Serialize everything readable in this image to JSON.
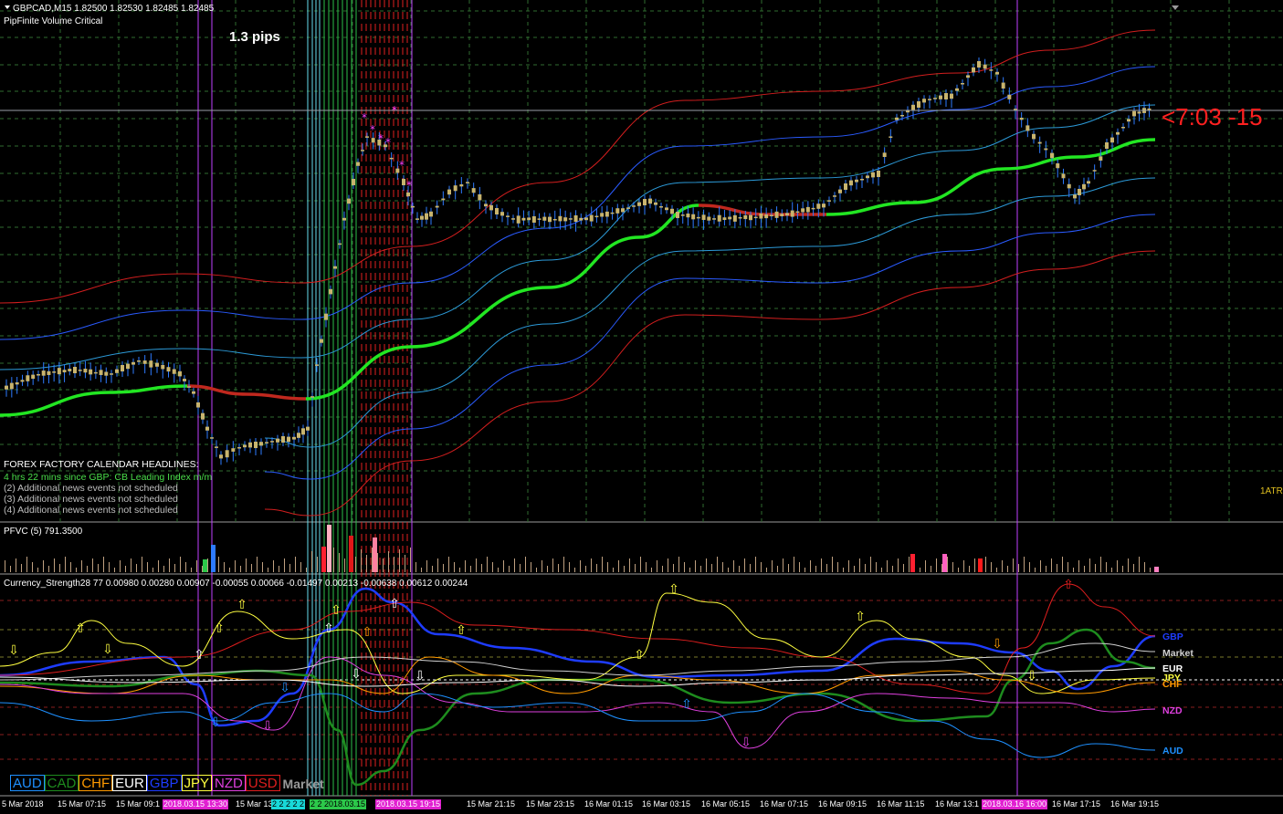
{
  "header": {
    "symbol_line": "GBPCAD,M15  1.82500 1.82530 1.82485 1.82485",
    "indicator_name": "PipFinite Volume Critical"
  },
  "spread_label": "1.3 pips",
  "timer_label": "<7:03  -15",
  "atr_label": "1ATR",
  "news": {
    "title": "FOREX FACTORY CALENDAR HEADLINES:",
    "line1": "4 hrs 22 mins since GBP: CB Leading Index m/m",
    "line2": "(2)  Additional news events not scheduled",
    "line3": "(3)  Additional news events not scheduled",
    "line4": "(4)  Additional news events not scheduled"
  },
  "pfvc_label": "PFVC (5) 791.3500",
  "cs_label": "Currency_Strength28 77 0.00980 0.00280 0.00907 -0.00055 0.00066 -0.01497 0.00213 -0.00638 0.00612 0.00244",
  "currency_labels": {
    "gbp": "GBP",
    "market": "Market",
    "eur": "EUR",
    "jpy": "JPY",
    "chf": "CHF",
    "nzd": "NZD",
    "aud": "AUD"
  },
  "legend": {
    "aud": "AUD",
    "cad": "CAD",
    "chf": "CHF",
    "eur": "EUR",
    "gbp": "GBP",
    "jpy": "JPY",
    "nzd": "NZD",
    "usd": "USD",
    "market": "Market"
  },
  "time_axis": {
    "t1": "5 Mar 2018",
    "t2": "15 Mar 07:15",
    "t3": "15 Mar 09:1",
    "hl1": "2018.03.15 13:30",
    "t4": "15 Mar 13",
    "hl2": "2 2 2 2 2",
    "hl3": "2 2 2018.03.15",
    "hl4": "2018.03.15 19:15",
    "t5": "15 Mar 21:15",
    "t6": "15 Mar 23:15",
    "t7": "16 Mar 01:15",
    "t8": "16 Mar 03:15",
    "t9": "16 Mar 05:15",
    "t10": "16 Mar 07:15",
    "t11": "16 Mar 09:15",
    "t12": "16 Mar 11:15",
    "t13": "16 Mar 13:1",
    "hl5": "2018.03.16 16:00",
    "t14": "16 Mar 17:15",
    "t15": "16 Mar 19:15"
  },
  "colors": {
    "background": "#000000",
    "grid": "#2f6b2f",
    "bull_candle": "#c8b46e",
    "bear_candle": "#c8b46e",
    "wick": "#2e7bff",
    "mid_line": "#22e622",
    "mid_line_bear": "#c0281e",
    "band_red": "#d21e1e",
    "band_blue": "#2a5bff",
    "band_cyan": "#2c9ad8",
    "news_green": "#4ade4a",
    "news_gray": "#bfbfbf",
    "magenta_line": "#c040ff",
    "red_dash": "#e02020",
    "green_vline": "#2bbf4a",
    "cyan_vline": "#66ddee",
    "gbp": "#1e3cff",
    "market": "#d0d0d0",
    "eur": "#ffffff",
    "jpy": "#ffff40",
    "chf": "#ff9a00",
    "nzd": "#e040e0",
    "aud": "#1e90ff",
    "cad": "#1e8c1e",
    "usd": "#e01e1e"
  }
}
